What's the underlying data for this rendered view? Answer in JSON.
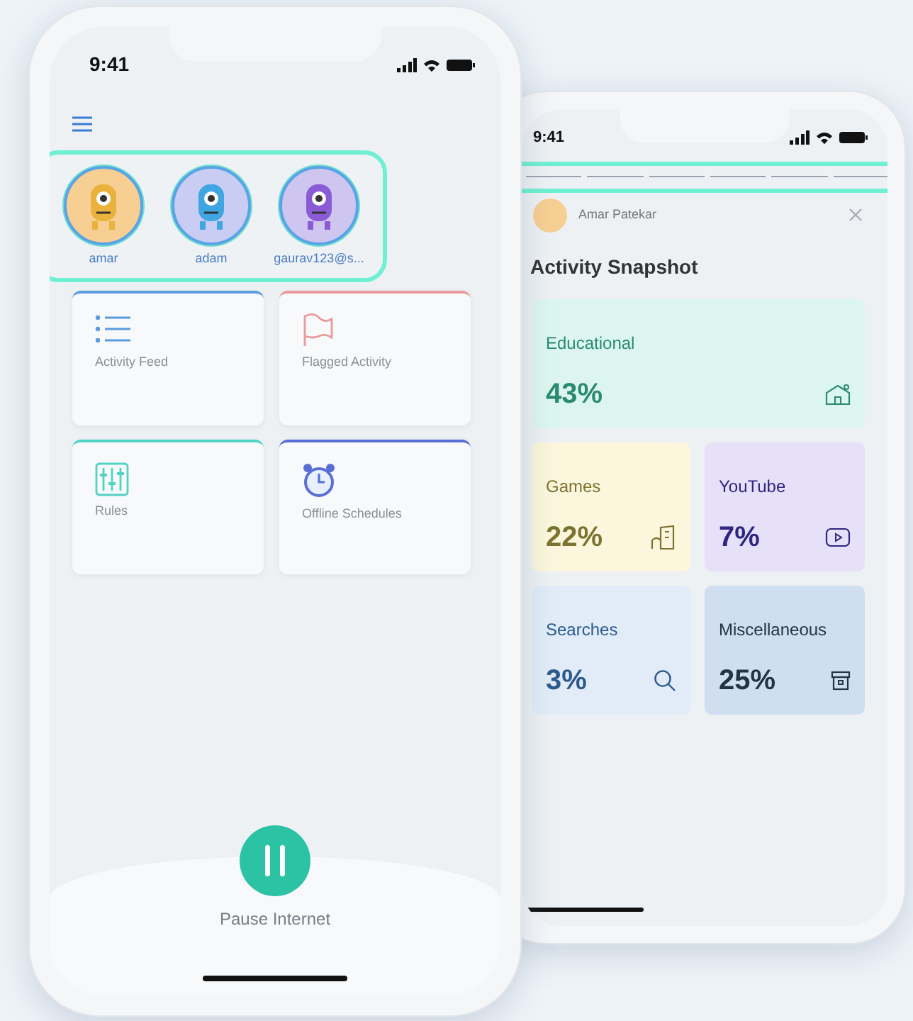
{
  "phones": [
    {
      "kind": "home",
      "status_time": "9:41",
      "profiles": [
        {
          "name": "amar",
          "color": "#f7cf93"
        },
        {
          "name": "adam",
          "color": "#c9cdf3"
        },
        {
          "name": "gaurav123@s...",
          "color": "#cfc6f0"
        }
      ],
      "tiles": [
        {
          "label": "Activity Feed",
          "color": "#5b9be0"
        },
        {
          "label": "Flagged Activity",
          "color": "#e89a9a"
        },
        {
          "label": "Rules",
          "color": "#53d1c4"
        },
        {
          "label": "Offline Schedules",
          "color": "#5a6fd6"
        }
      ],
      "pause_label": "Pause Internet"
    },
    {
      "kind": "snapshot",
      "status_time": "9:41",
      "user": "Amar Patekar",
      "title": "Activity Snapshot",
      "categories": [
        {
          "label": "Educational",
          "value": "43%",
          "color": "#dcf6ef"
        },
        {
          "label": "Games",
          "value": "22%",
          "color": "#fbf6dc"
        },
        {
          "label": "YouTube",
          "value": "7%",
          "color": "#e6e1f8"
        },
        {
          "label": "Searches",
          "value": "3%",
          "color": "#e1ecf8"
        },
        {
          "label": "Miscellaneous",
          "value": "25%",
          "color": "#cfdff0"
        }
      ]
    }
  ]
}
